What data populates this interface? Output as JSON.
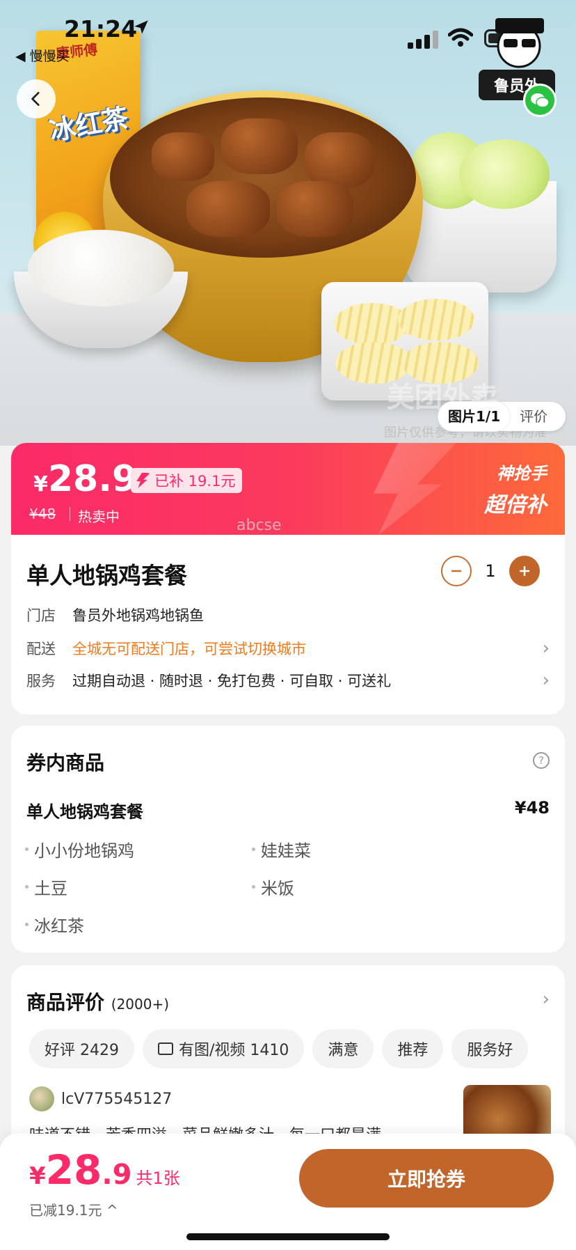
{
  "status_bar": {
    "time": "21:24",
    "back_app": "◀ 慢慢买"
  },
  "hero": {
    "drink_brand": "康师傅",
    "drink_name": "冰红茶",
    "watermark": "美团外卖",
    "watermark_sub": "图片仅供参考，请以实物为准",
    "mascot_label": "鲁员外",
    "tabs": [
      {
        "label": "图片1/1"
      },
      {
        "label": "评价"
      }
    ]
  },
  "price": {
    "currency": "¥",
    "amount": "28.9",
    "subsidy": "已补 19.1元",
    "original": "¥48",
    "status": "热卖中",
    "promo_line1": "神抢手",
    "promo_line2": "超倍补"
  },
  "product": {
    "title": "单人地锅鸡套餐",
    "quantity": "1",
    "ghost_mark": "abcse",
    "rows": [
      {
        "label": "门店",
        "value": "鲁员外地锅鸡地锅鱼"
      },
      {
        "label": "配送",
        "value": "全城无可配送门店，可尝试切换城市"
      },
      {
        "label": "服务",
        "value": "过期自动退 · 随时退 · 免打包费 · 可自取 · 可送礼"
      }
    ]
  },
  "coupon_items": {
    "title": "券内商品",
    "package_name": "单人地锅鸡套餐",
    "package_price": "¥48",
    "items": [
      "小小份地锅鸡",
      "娃娃菜",
      "土豆",
      "米饭",
      "冰红茶"
    ]
  },
  "reviews": {
    "title": "商品评价",
    "count": "(2000+)",
    "chips": [
      {
        "label": "好评 2429"
      },
      {
        "label": "有图/视频 1410"
      },
      {
        "label": "满意"
      },
      {
        "label": "推荐"
      },
      {
        "label": "服务好"
      }
    ],
    "user": "lcV775545127",
    "text": "味道不错，芳香四溢，菜品鲜嫩多汁，每一口都是满"
  },
  "bottom_bar": {
    "currency": "¥",
    "amount_int": "28",
    "amount_dec": ".9",
    "count": "共1张",
    "saved": "已减19.1元 ^",
    "cta": "立即抢券"
  },
  "colors": {
    "accent_pink": "#fb2a68",
    "cta_brown": "#c1652a",
    "orange_text": "#f07a1e"
  }
}
